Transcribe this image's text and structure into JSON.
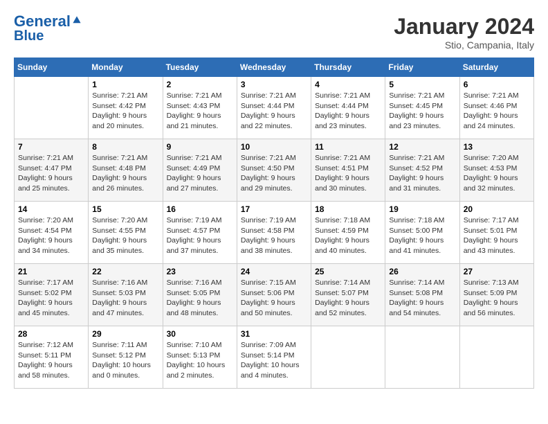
{
  "header": {
    "logo_line1": "General",
    "logo_line2": "Blue",
    "month": "January 2024",
    "location": "Stio, Campania, Italy"
  },
  "days_of_week": [
    "Sunday",
    "Monday",
    "Tuesday",
    "Wednesday",
    "Thursday",
    "Friday",
    "Saturday"
  ],
  "weeks": [
    [
      {
        "day": "",
        "info": ""
      },
      {
        "day": "1",
        "info": "Sunrise: 7:21 AM\nSunset: 4:42 PM\nDaylight: 9 hours\nand 20 minutes."
      },
      {
        "day": "2",
        "info": "Sunrise: 7:21 AM\nSunset: 4:43 PM\nDaylight: 9 hours\nand 21 minutes."
      },
      {
        "day": "3",
        "info": "Sunrise: 7:21 AM\nSunset: 4:44 PM\nDaylight: 9 hours\nand 22 minutes."
      },
      {
        "day": "4",
        "info": "Sunrise: 7:21 AM\nSunset: 4:44 PM\nDaylight: 9 hours\nand 23 minutes."
      },
      {
        "day": "5",
        "info": "Sunrise: 7:21 AM\nSunset: 4:45 PM\nDaylight: 9 hours\nand 23 minutes."
      },
      {
        "day": "6",
        "info": "Sunrise: 7:21 AM\nSunset: 4:46 PM\nDaylight: 9 hours\nand 24 minutes."
      }
    ],
    [
      {
        "day": "7",
        "info": "Sunrise: 7:21 AM\nSunset: 4:47 PM\nDaylight: 9 hours\nand 25 minutes."
      },
      {
        "day": "8",
        "info": "Sunrise: 7:21 AM\nSunset: 4:48 PM\nDaylight: 9 hours\nand 26 minutes."
      },
      {
        "day": "9",
        "info": "Sunrise: 7:21 AM\nSunset: 4:49 PM\nDaylight: 9 hours\nand 27 minutes."
      },
      {
        "day": "10",
        "info": "Sunrise: 7:21 AM\nSunset: 4:50 PM\nDaylight: 9 hours\nand 29 minutes."
      },
      {
        "day": "11",
        "info": "Sunrise: 7:21 AM\nSunset: 4:51 PM\nDaylight: 9 hours\nand 30 minutes."
      },
      {
        "day": "12",
        "info": "Sunrise: 7:21 AM\nSunset: 4:52 PM\nDaylight: 9 hours\nand 31 minutes."
      },
      {
        "day": "13",
        "info": "Sunrise: 7:20 AM\nSunset: 4:53 PM\nDaylight: 9 hours\nand 32 minutes."
      }
    ],
    [
      {
        "day": "14",
        "info": "Sunrise: 7:20 AM\nSunset: 4:54 PM\nDaylight: 9 hours\nand 34 minutes."
      },
      {
        "day": "15",
        "info": "Sunrise: 7:20 AM\nSunset: 4:55 PM\nDaylight: 9 hours\nand 35 minutes."
      },
      {
        "day": "16",
        "info": "Sunrise: 7:19 AM\nSunset: 4:57 PM\nDaylight: 9 hours\nand 37 minutes."
      },
      {
        "day": "17",
        "info": "Sunrise: 7:19 AM\nSunset: 4:58 PM\nDaylight: 9 hours\nand 38 minutes."
      },
      {
        "day": "18",
        "info": "Sunrise: 7:18 AM\nSunset: 4:59 PM\nDaylight: 9 hours\nand 40 minutes."
      },
      {
        "day": "19",
        "info": "Sunrise: 7:18 AM\nSunset: 5:00 PM\nDaylight: 9 hours\nand 41 minutes."
      },
      {
        "day": "20",
        "info": "Sunrise: 7:17 AM\nSunset: 5:01 PM\nDaylight: 9 hours\nand 43 minutes."
      }
    ],
    [
      {
        "day": "21",
        "info": "Sunrise: 7:17 AM\nSunset: 5:02 PM\nDaylight: 9 hours\nand 45 minutes."
      },
      {
        "day": "22",
        "info": "Sunrise: 7:16 AM\nSunset: 5:03 PM\nDaylight: 9 hours\nand 47 minutes."
      },
      {
        "day": "23",
        "info": "Sunrise: 7:16 AM\nSunset: 5:05 PM\nDaylight: 9 hours\nand 48 minutes."
      },
      {
        "day": "24",
        "info": "Sunrise: 7:15 AM\nSunset: 5:06 PM\nDaylight: 9 hours\nand 50 minutes."
      },
      {
        "day": "25",
        "info": "Sunrise: 7:14 AM\nSunset: 5:07 PM\nDaylight: 9 hours\nand 52 minutes."
      },
      {
        "day": "26",
        "info": "Sunrise: 7:14 AM\nSunset: 5:08 PM\nDaylight: 9 hours\nand 54 minutes."
      },
      {
        "day": "27",
        "info": "Sunrise: 7:13 AM\nSunset: 5:09 PM\nDaylight: 9 hours\nand 56 minutes."
      }
    ],
    [
      {
        "day": "28",
        "info": "Sunrise: 7:12 AM\nSunset: 5:11 PM\nDaylight: 9 hours\nand 58 minutes."
      },
      {
        "day": "29",
        "info": "Sunrise: 7:11 AM\nSunset: 5:12 PM\nDaylight: 10 hours\nand 0 minutes."
      },
      {
        "day": "30",
        "info": "Sunrise: 7:10 AM\nSunset: 5:13 PM\nDaylight: 10 hours\nand 2 minutes."
      },
      {
        "day": "31",
        "info": "Sunrise: 7:09 AM\nSunset: 5:14 PM\nDaylight: 10 hours\nand 4 minutes."
      },
      {
        "day": "",
        "info": ""
      },
      {
        "day": "",
        "info": ""
      },
      {
        "day": "",
        "info": ""
      }
    ]
  ]
}
